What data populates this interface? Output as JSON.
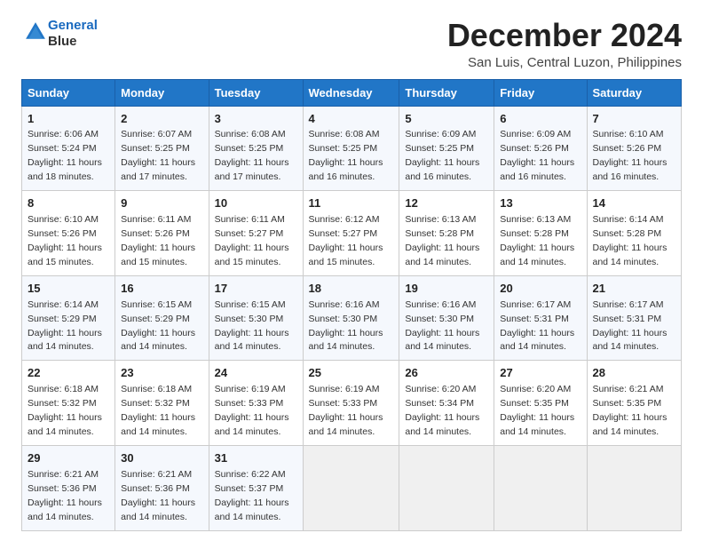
{
  "header": {
    "logo_line1": "General",
    "logo_line2": "Blue",
    "month": "December 2024",
    "location": "San Luis, Central Luzon, Philippines"
  },
  "weekdays": [
    "Sunday",
    "Monday",
    "Tuesday",
    "Wednesday",
    "Thursday",
    "Friday",
    "Saturday"
  ],
  "weeks": [
    [
      {
        "day": 1,
        "sunrise": "6:06 AM",
        "sunset": "5:24 PM",
        "daylight": "11 hours and 18 minutes."
      },
      {
        "day": 2,
        "sunrise": "6:07 AM",
        "sunset": "5:25 PM",
        "daylight": "11 hours and 17 minutes."
      },
      {
        "day": 3,
        "sunrise": "6:08 AM",
        "sunset": "5:25 PM",
        "daylight": "11 hours and 17 minutes."
      },
      {
        "day": 4,
        "sunrise": "6:08 AM",
        "sunset": "5:25 PM",
        "daylight": "11 hours and 16 minutes."
      },
      {
        "day": 5,
        "sunrise": "6:09 AM",
        "sunset": "5:25 PM",
        "daylight": "11 hours and 16 minutes."
      },
      {
        "day": 6,
        "sunrise": "6:09 AM",
        "sunset": "5:26 PM",
        "daylight": "11 hours and 16 minutes."
      },
      {
        "day": 7,
        "sunrise": "6:10 AM",
        "sunset": "5:26 PM",
        "daylight": "11 hours and 16 minutes."
      }
    ],
    [
      {
        "day": 8,
        "sunrise": "6:10 AM",
        "sunset": "5:26 PM",
        "daylight": "11 hours and 15 minutes."
      },
      {
        "day": 9,
        "sunrise": "6:11 AM",
        "sunset": "5:26 PM",
        "daylight": "11 hours and 15 minutes."
      },
      {
        "day": 10,
        "sunrise": "6:11 AM",
        "sunset": "5:27 PM",
        "daylight": "11 hours and 15 minutes."
      },
      {
        "day": 11,
        "sunrise": "6:12 AM",
        "sunset": "5:27 PM",
        "daylight": "11 hours and 15 minutes."
      },
      {
        "day": 12,
        "sunrise": "6:13 AM",
        "sunset": "5:28 PM",
        "daylight": "11 hours and 14 minutes."
      },
      {
        "day": 13,
        "sunrise": "6:13 AM",
        "sunset": "5:28 PM",
        "daylight": "11 hours and 14 minutes."
      },
      {
        "day": 14,
        "sunrise": "6:14 AM",
        "sunset": "5:28 PM",
        "daylight": "11 hours and 14 minutes."
      }
    ],
    [
      {
        "day": 15,
        "sunrise": "6:14 AM",
        "sunset": "5:29 PM",
        "daylight": "11 hours and 14 minutes."
      },
      {
        "day": 16,
        "sunrise": "6:15 AM",
        "sunset": "5:29 PM",
        "daylight": "11 hours and 14 minutes."
      },
      {
        "day": 17,
        "sunrise": "6:15 AM",
        "sunset": "5:30 PM",
        "daylight": "11 hours and 14 minutes."
      },
      {
        "day": 18,
        "sunrise": "6:16 AM",
        "sunset": "5:30 PM",
        "daylight": "11 hours and 14 minutes."
      },
      {
        "day": 19,
        "sunrise": "6:16 AM",
        "sunset": "5:30 PM",
        "daylight": "11 hours and 14 minutes."
      },
      {
        "day": 20,
        "sunrise": "6:17 AM",
        "sunset": "5:31 PM",
        "daylight": "11 hours and 14 minutes."
      },
      {
        "day": 21,
        "sunrise": "6:17 AM",
        "sunset": "5:31 PM",
        "daylight": "11 hours and 14 minutes."
      }
    ],
    [
      {
        "day": 22,
        "sunrise": "6:18 AM",
        "sunset": "5:32 PM",
        "daylight": "11 hours and 14 minutes."
      },
      {
        "day": 23,
        "sunrise": "6:18 AM",
        "sunset": "5:32 PM",
        "daylight": "11 hours and 14 minutes."
      },
      {
        "day": 24,
        "sunrise": "6:19 AM",
        "sunset": "5:33 PM",
        "daylight": "11 hours and 14 minutes."
      },
      {
        "day": 25,
        "sunrise": "6:19 AM",
        "sunset": "5:33 PM",
        "daylight": "11 hours and 14 minutes."
      },
      {
        "day": 26,
        "sunrise": "6:20 AM",
        "sunset": "5:34 PM",
        "daylight": "11 hours and 14 minutes."
      },
      {
        "day": 27,
        "sunrise": "6:20 AM",
        "sunset": "5:35 PM",
        "daylight": "11 hours and 14 minutes."
      },
      {
        "day": 28,
        "sunrise": "6:21 AM",
        "sunset": "5:35 PM",
        "daylight": "11 hours and 14 minutes."
      }
    ],
    [
      {
        "day": 29,
        "sunrise": "6:21 AM",
        "sunset": "5:36 PM",
        "daylight": "11 hours and 14 minutes."
      },
      {
        "day": 30,
        "sunrise": "6:21 AM",
        "sunset": "5:36 PM",
        "daylight": "11 hours and 14 minutes."
      },
      {
        "day": 31,
        "sunrise": "6:22 AM",
        "sunset": "5:37 PM",
        "daylight": "11 hours and 14 minutes."
      },
      null,
      null,
      null,
      null
    ]
  ]
}
